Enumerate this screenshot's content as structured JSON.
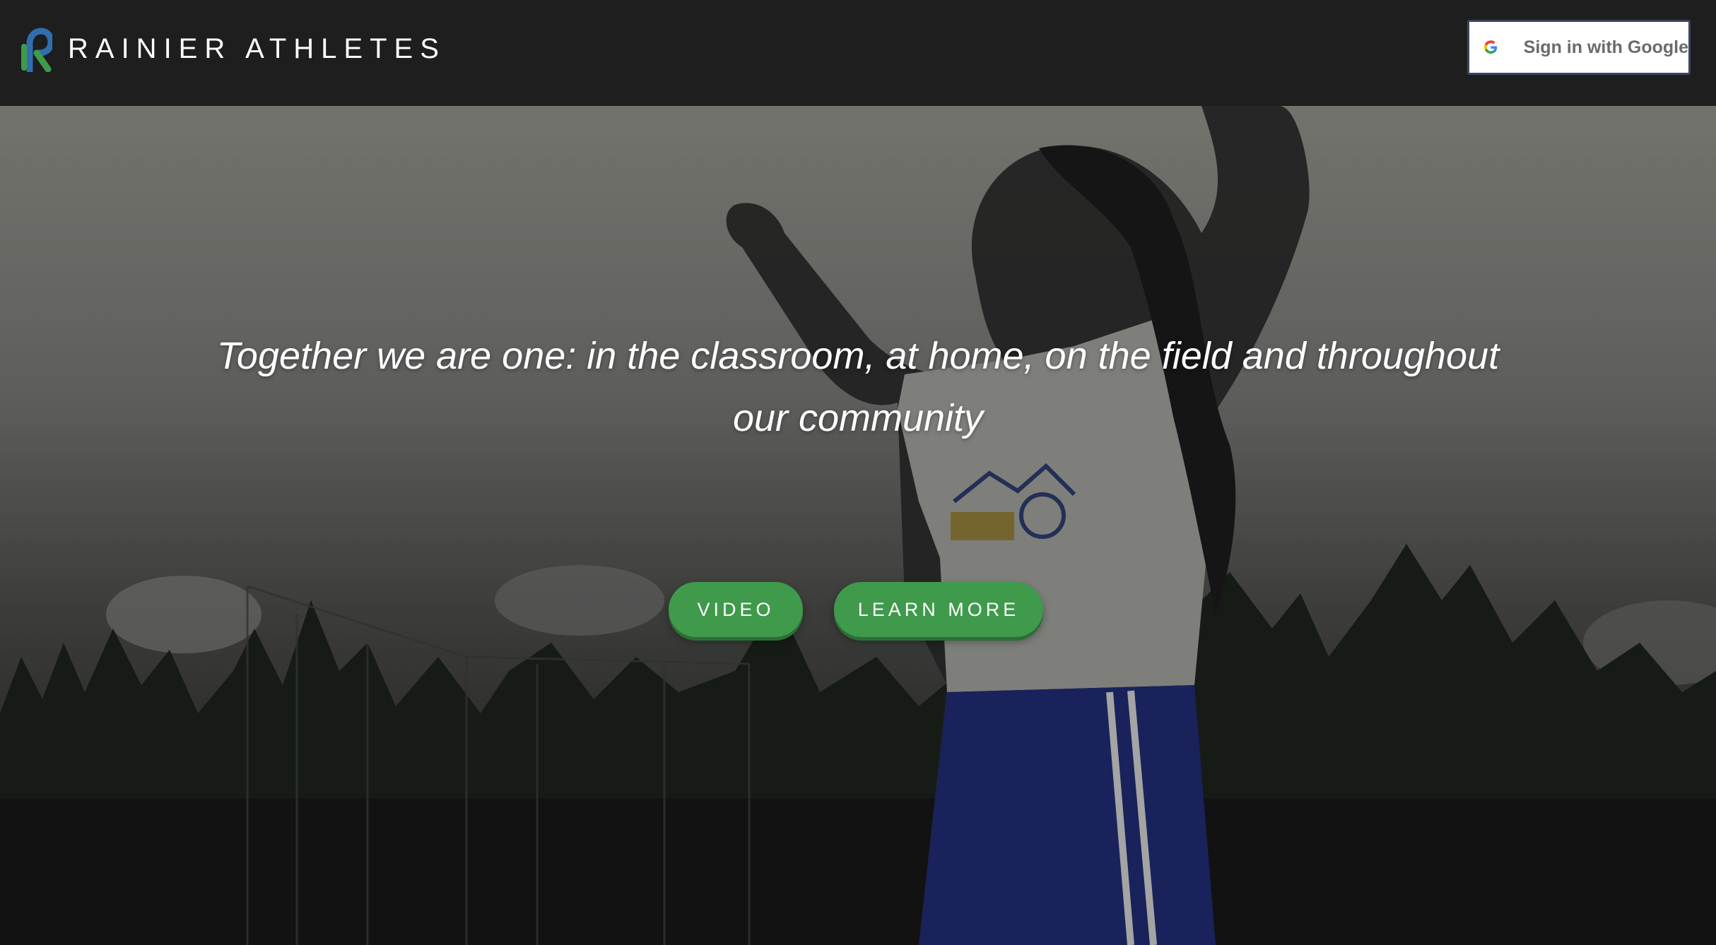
{
  "header": {
    "brand": "RAINIER ATHLETES",
    "logo_icon": "rainier-r-logo",
    "signin": {
      "label": "Sign in with Google",
      "icon": "google-g-icon"
    }
  },
  "hero": {
    "tagline": "Together we are one: in the classroom, at home, on the field and throughout our community",
    "buttons": {
      "video": "VIDEO",
      "learn_more": "LEARN MORE"
    }
  },
  "colors": {
    "header_bg": "#1e1e1e",
    "accent_green": "#3f9a4c",
    "logo_blue": "#2f6fb0",
    "logo_green": "#3f9a4c"
  }
}
